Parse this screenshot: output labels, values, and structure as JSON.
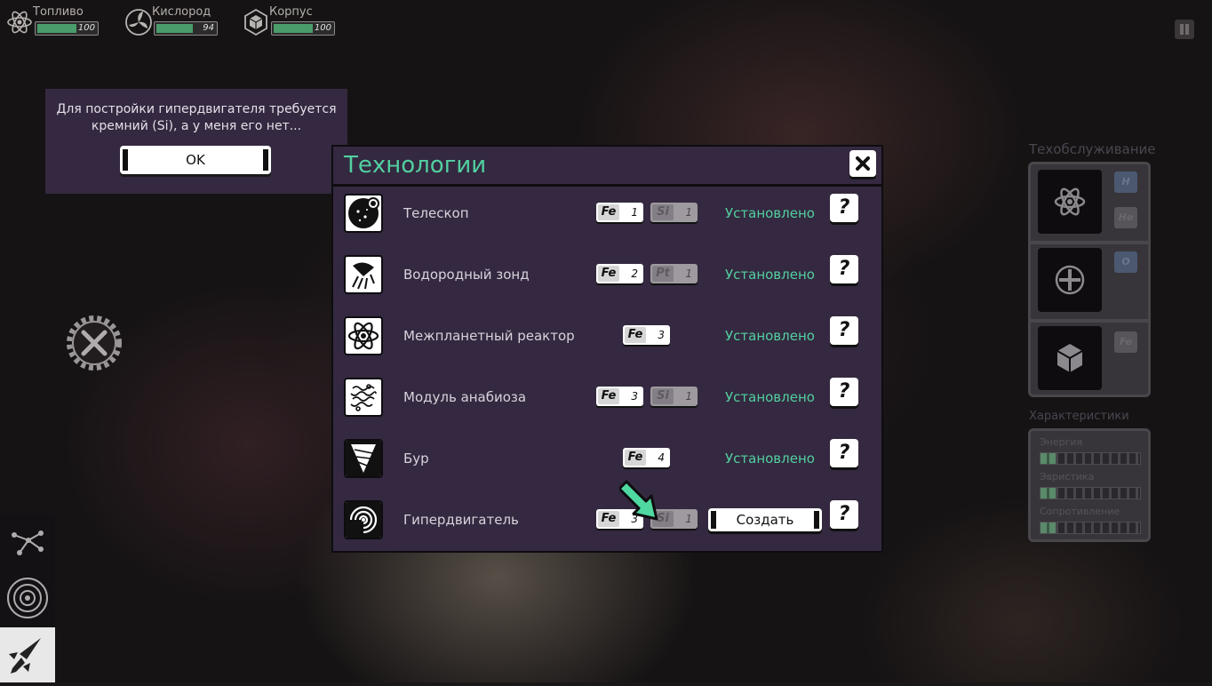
{
  "hud": {
    "stats": [
      {
        "label": "Топливо",
        "value": "100",
        "level": 1.0,
        "icon": "atom-icon"
      },
      {
        "label": "Кислород",
        "value": "94",
        "level": 0.94,
        "icon": "fan-icon"
      },
      {
        "label": "Корпус",
        "value": "100",
        "level": 1.0,
        "icon": "hexagon-cube-icon"
      }
    ],
    "pause_icon": "pause-icon"
  },
  "message": {
    "text": "Для постройки гипердвигателя требуется кремний (Si), а у меня его нет...",
    "ok_label": "OK"
  },
  "tech_panel": {
    "title": "Технологии",
    "close_icon": "close-icon",
    "create_label": "Создать",
    "help_label": "?",
    "items": [
      {
        "name": "Телескоп",
        "icon": "telescope-icon",
        "cost": [
          {
            "sym": "Fe",
            "n": "1",
            "have": true
          },
          {
            "sym": "Si",
            "n": "1",
            "have": false
          }
        ],
        "status": "Установлено"
      },
      {
        "name": "Водородный зонд",
        "icon": "probe-icon",
        "cost": [
          {
            "sym": "Fe",
            "n": "2",
            "have": true
          },
          {
            "sym": "Pt",
            "n": "1",
            "have": false
          }
        ],
        "status": "Установлено"
      },
      {
        "name": "Межпланетный реактор",
        "icon": "reactor-icon",
        "cost": [
          {
            "sym": "Fe",
            "n": "3",
            "have": true
          }
        ],
        "status": "Установлено"
      },
      {
        "name": "Модуль анабиоза",
        "icon": "stasis-icon",
        "cost": [
          {
            "sym": "Fe",
            "n": "3",
            "have": true
          },
          {
            "sym": "Si",
            "n": "1",
            "have": false
          }
        ],
        "status": "Установлено"
      },
      {
        "name": "Бур",
        "icon": "drill-icon",
        "cost": [
          {
            "sym": "Fe",
            "n": "4",
            "have": true
          }
        ],
        "status": "Установлено"
      },
      {
        "name": "Гипердвигатель",
        "icon": "hyperdrive-icon",
        "cost": [
          {
            "sym": "Fe",
            "n": "3",
            "have": true
          },
          {
            "sym": "Si",
            "n": "1",
            "have": false
          }
        ],
        "status": ""
      }
    ]
  },
  "sidebar": {
    "tools_icon": "tools-gear-icon",
    "buttons": [
      {
        "icon": "star-map-icon",
        "active": false
      },
      {
        "icon": "orbit-icon",
        "active": false
      },
      {
        "icon": "rocket-icon",
        "active": true
      }
    ]
  },
  "maintenance": {
    "title": "Техобслуживание",
    "slots": [
      {
        "icon": "atom-icon",
        "chips": [
          "H",
          "He"
        ]
      },
      {
        "icon": "fan-icon",
        "chips": [
          "O"
        ]
      },
      {
        "icon": "hexagon-cube-icon",
        "chips": [
          "Fe"
        ]
      }
    ]
  },
  "characteristics": {
    "title": "Характеристики",
    "rows": [
      {
        "label": "Энергия",
        "level": 0.15
      },
      {
        "label": "Эвристика",
        "level": 0.15
      },
      {
        "label": "Сопротивление",
        "level": 0.15
      }
    ]
  }
}
